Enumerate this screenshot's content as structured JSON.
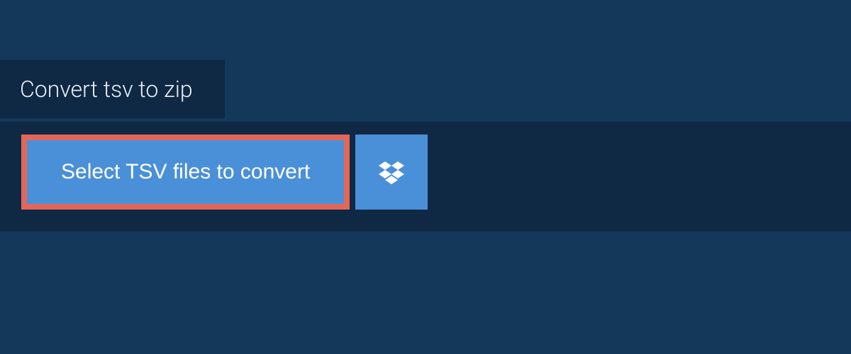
{
  "tab": {
    "label": "Convert tsv to zip"
  },
  "buttons": {
    "select_label": "Select TSV files to convert"
  },
  "colors": {
    "background": "#14385a",
    "panel": "#0f2843",
    "button": "#4a90d9",
    "highlight_border": "#e36759"
  }
}
